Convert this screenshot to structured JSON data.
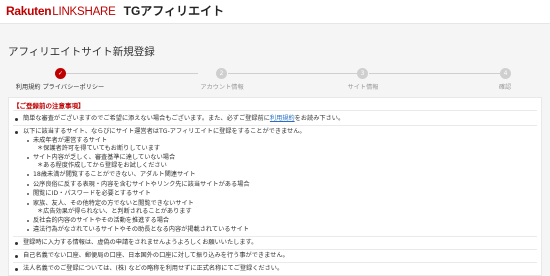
{
  "header": {
    "logo_rakuten": "Rakuten",
    "logo_linkshare": "LINKSHARE",
    "logo_tg": "TGアフィリエイト"
  },
  "page_title": "アフィリエイトサイト新規登録",
  "steps": [
    {
      "num": "✓",
      "label": "利用規約 プライバシーポリシー",
      "active": true
    },
    {
      "num": "2",
      "label": "アカウント情報",
      "active": false
    },
    {
      "num": "3",
      "label": "サイト情報",
      "active": false
    },
    {
      "num": "4",
      "label": "確認",
      "active": false
    }
  ],
  "notice_heading": "【ご登録前の注意事項】",
  "notice": {
    "item1_pre": "簡単な審査がございますのでご希望に添えない場合もございます。また、必ずご登録前に",
    "item1_link": "利用規約",
    "item1_post": "をお読み下さい。",
    "item2": "以下に該当するサイト、ならびにサイト運営者はTG-アフィリエイトに登録をすることができません。",
    "sub1": "未成年者が運営するサイト",
    "sub1_note": "＊保護者許可を得ていてもお断りしています",
    "sub2": "サイト内容が乏しく、審査基準に達していない場合",
    "sub2_note": "＊ある程度作成してから登録をお試しください",
    "sub3": "18歳未満が閲覧することができない、アダルト関連サイト",
    "sub4": "公序良俗に反する表現・内容を含むサイトやリンク先に該当サイトがある場合",
    "sub5": "閲覧にID・パスワードを必要とするサイト",
    "sub6": "家族、友人、その他特定の方でないと閲覧できないサイト",
    "sub6_note": "＊広告効果が得られない、と判断されることがあります",
    "sub7": "反社会的内容のサイトやその活動を推進する場合",
    "sub8": "違法行為がなされているサイトやその助長となる内容が掲載されているサイト",
    "item3": "登録時に入力する情報は、虚偽の申請をされませんようよろしくお願いいたします。",
    "item4": "自己名義でない口座、郵便局の口座、日本国外の口座に対して振り込みを行う事ができません。",
    "item5": "法人名義でのご登録については、(株) などの略称を利用せずに正式名称にてご登録ください。"
  }
}
